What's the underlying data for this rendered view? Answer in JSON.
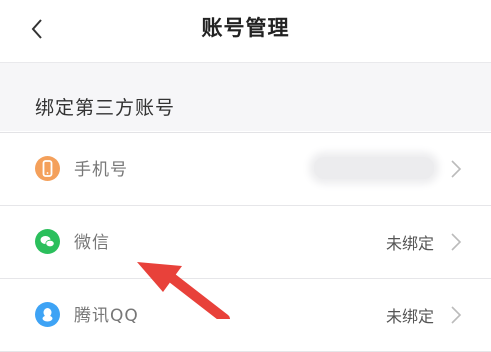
{
  "header": {
    "title": "账号管理",
    "back_icon": "chevron-left-icon"
  },
  "section": {
    "title": "绑定第三方账号"
  },
  "accounts": [
    {
      "label": "手机号",
      "value": "",
      "icon": "phone-icon",
      "color": "#f4a05b",
      "value_blurred": true
    },
    {
      "label": "微信",
      "value": "未绑定",
      "icon": "wechat-icon",
      "color": "#2bbf5c"
    },
    {
      "label": "腾讯QQ",
      "value": "未绑定",
      "icon": "qq-icon",
      "color": "#3ea3f5"
    }
  ],
  "annotation": {
    "color": "#e8413a"
  }
}
